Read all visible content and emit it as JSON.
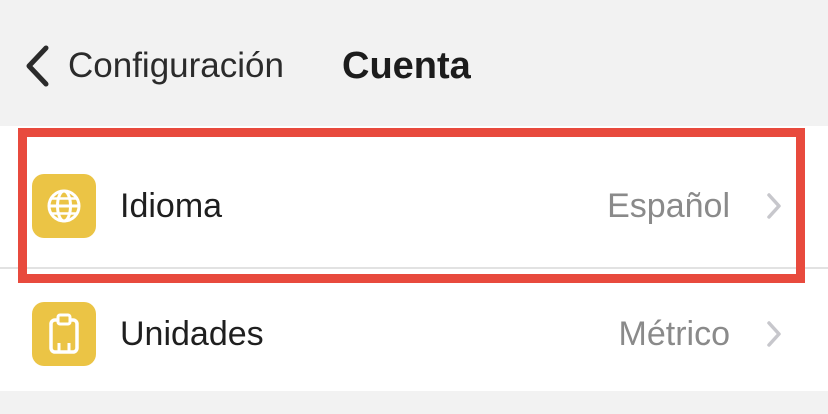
{
  "nav": {
    "back_label": "Configuración",
    "title": "Cuenta",
    "back_icon": "chevron-left-icon"
  },
  "settings": {
    "items": [
      {
        "label": "Idioma",
        "value": "Español",
        "icon": "globe-icon",
        "highlighted": true
      },
      {
        "label": "Unidades",
        "value": "Métrico",
        "icon": "clipboard-icon",
        "highlighted": false
      }
    ]
  },
  "colors": {
    "background": "#f2f2f2",
    "list_background": "#ffffff",
    "icon_background": "#ebc445",
    "highlight_border": "#e84a3d",
    "value_text": "#8a8a8a",
    "chevron": "#c7c7cc"
  }
}
